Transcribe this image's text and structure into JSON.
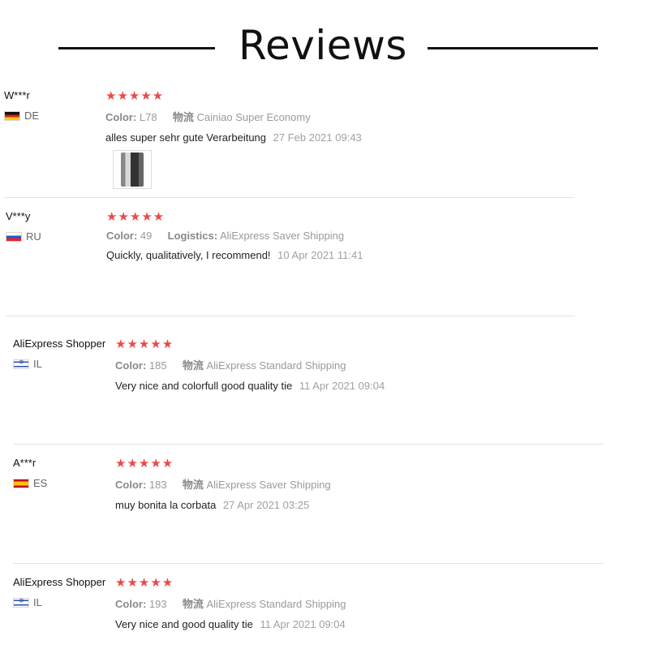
{
  "header": {
    "title": "Reviews"
  },
  "colors": {
    "star": "#e94a4a",
    "divider": "#e3e3e3",
    "muted_text": "#9a9a9a"
  },
  "icons": {
    "star": "star-icon",
    "flag": "flag-icon",
    "review_image": "image-thumbnail"
  },
  "reviews": [
    {
      "user": "W***r",
      "country": "DE",
      "rating": 5,
      "stars": "★★★★★",
      "color_label": "Color:",
      "color_value": "L78",
      "shipping_label": "物流",
      "shipping_value": "Cainiao Super Economy",
      "text": "alles super sehr gute Verarbeitung",
      "date": "27 Feb 2021 09:43",
      "has_image": true
    },
    {
      "user": "V***y",
      "country": "RU",
      "rating": 5,
      "stars": "★★★★★",
      "color_label": "Color:",
      "color_value": "49",
      "shipping_label": "Logistics:",
      "shipping_value": "AliExpress Saver Shipping",
      "text": "Quickly, qualitatively, I recommend!",
      "date": "10 Apr 2021 11:41",
      "has_image": false
    },
    {
      "user": "AliExpress Shopper",
      "country": "IL",
      "rating": 5,
      "stars": "★★★★★",
      "color_label": "Color:",
      "color_value": "185",
      "shipping_label": "物流",
      "shipping_value": "AliExpress Standard Shipping",
      "text": "Very nice and colorfull good quality tie",
      "date": "11 Apr 2021 09:04",
      "has_image": false
    },
    {
      "user": "A***r",
      "country": "ES",
      "rating": 5,
      "stars": "★★★★★",
      "color_label": "Color:",
      "color_value": "183",
      "shipping_label": "物流",
      "shipping_value": "AliExpress Saver Shipping",
      "text": "muy bonita la corbata",
      "date": "27 Apr 2021 03:25",
      "has_image": false
    },
    {
      "user": "AliExpress Shopper",
      "country": "IL",
      "rating": 5,
      "stars": "★★★★★",
      "color_label": "Color:",
      "color_value": "193",
      "shipping_label": "物流",
      "shipping_value": "AliExpress Standard Shipping",
      "text": "Very nice and good quality tie",
      "date": "11 Apr 2021 09:04",
      "has_image": false
    }
  ]
}
